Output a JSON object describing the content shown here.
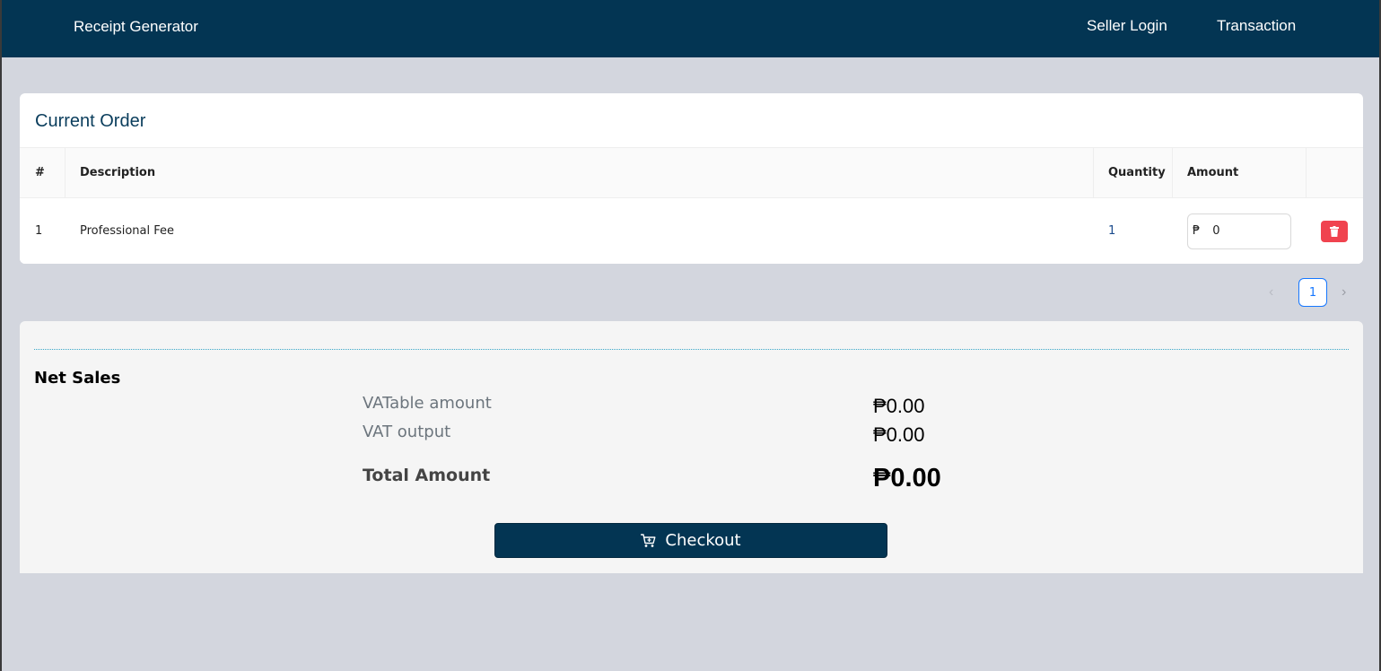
{
  "header": {
    "brand": "Receipt Generator",
    "nav": {
      "seller_login": "Seller Login",
      "transaction": "Transaction"
    }
  },
  "order": {
    "title": "Current Order",
    "columns": {
      "num": "#",
      "description": "Description",
      "quantity": "Quantity",
      "amount": "Amount"
    },
    "rows": [
      {
        "num": "1",
        "description": "Professional Fee",
        "quantity": "1",
        "currency": "₱",
        "amount": "0"
      }
    ]
  },
  "pagination": {
    "current_page": "1",
    "prev_icon": "chevron-left-icon",
    "next_icon": "chevron-right-icon"
  },
  "summary": {
    "net_sales_label": "Net Sales",
    "vatable_label": "VATable amount",
    "vatable_value": "₱0.00",
    "vat_output_label": "VAT output",
    "vat_output_value": "₱0.00",
    "total_label": "Total Amount",
    "total_value": "₱0.00"
  },
  "checkout": {
    "label": "Checkout",
    "icon": "cart-icon"
  },
  "colors": {
    "primary": "#033553",
    "danger": "#f0434f",
    "link": "#1677ff",
    "background": "#d3d6de"
  }
}
